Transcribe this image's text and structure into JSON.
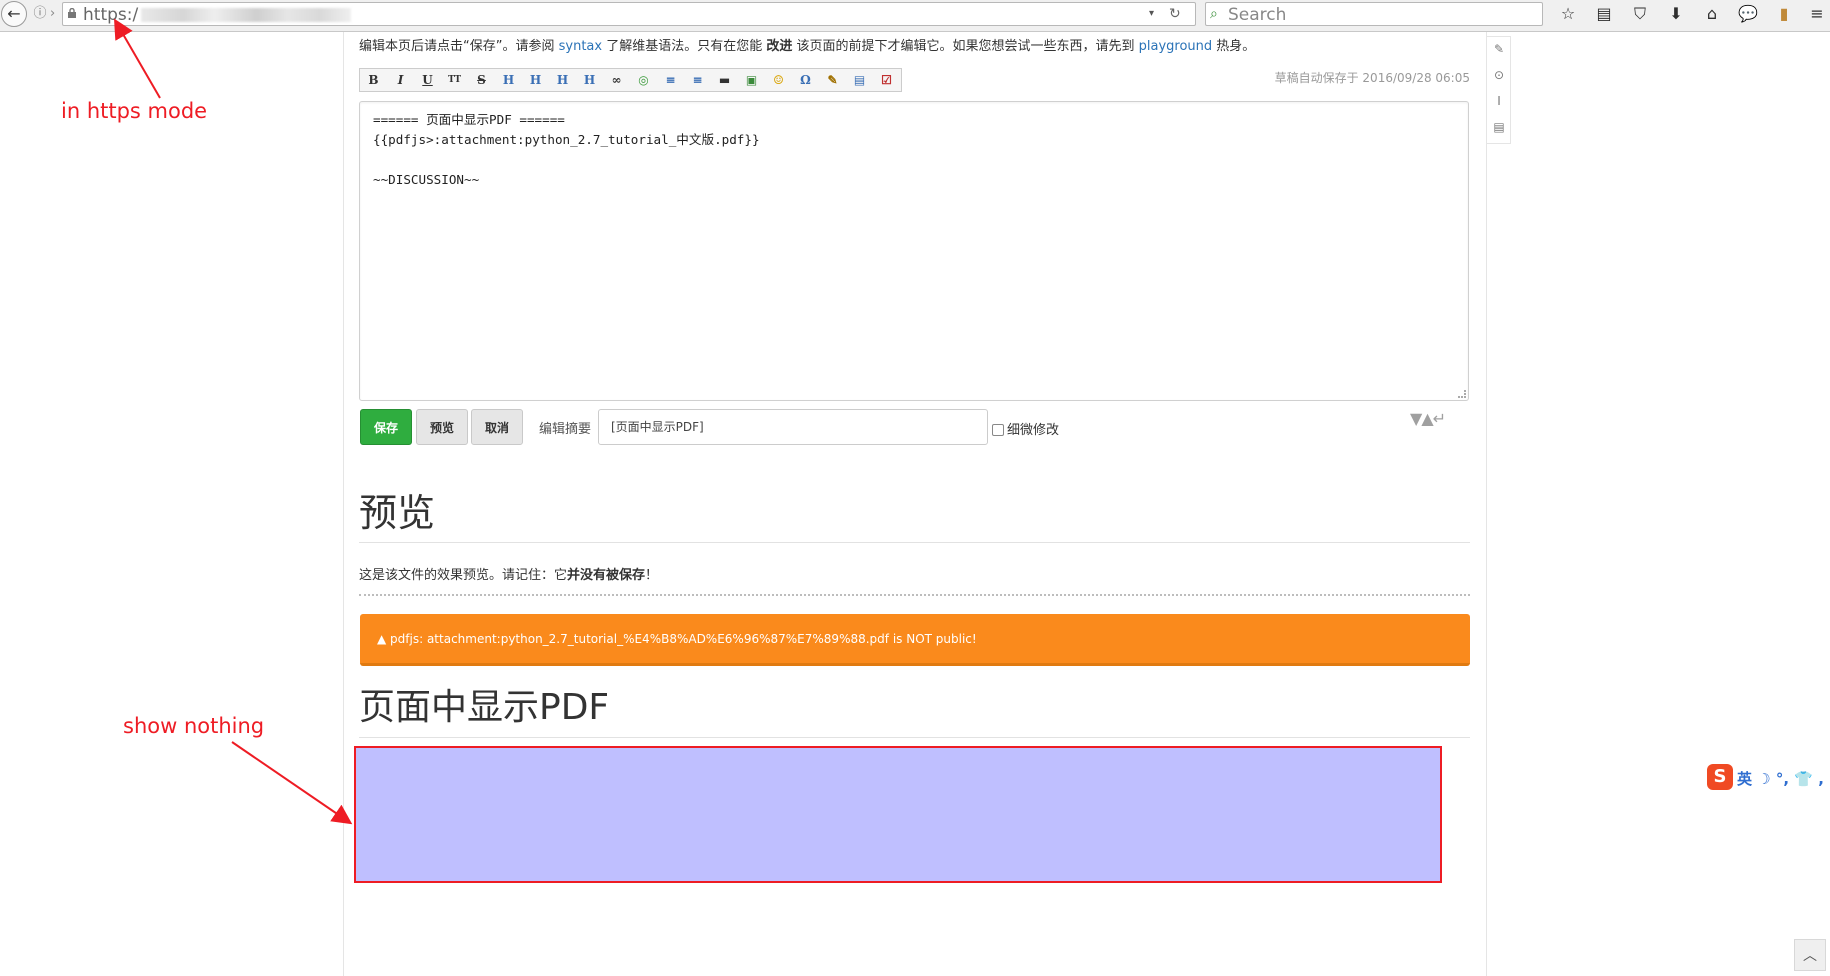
{
  "browser": {
    "url_visible": "https:/",
    "search_placeholder": "Search",
    "url_dropdown_glyph": "▾",
    "reload_glyph": "↻",
    "toolbar_icons": [
      "star-icon",
      "reading-list-icon",
      "pocket-icon",
      "download-icon",
      "home-icon",
      "chat-icon",
      "extension-icon",
      "menu-icon"
    ]
  },
  "intro": {
    "part1": "编辑本页后请点击“保存”。请参阅 ",
    "syntax_link": "syntax",
    "part2": " 了解维基语法。只有在您能 ",
    "improve": "改进",
    "part3": " 该页面的前提下才编辑它。如果您想尝试一些东西，请先到 ",
    "playground_link": "playground",
    "part4": " 热身。"
  },
  "edit_toolbar": [
    "B",
    "I",
    "U",
    "TT",
    "S",
    "H",
    "H",
    "H",
    "H",
    "∞",
    "◎",
    "≡",
    "≡",
    "▬",
    "▣",
    "☺",
    "Ω",
    "✎",
    "▤",
    "☑"
  ],
  "draft": "草稿自动保存于 2016/09/28 06:05",
  "editor": {
    "content": "====== 页面中显示PDF ======\n{{pdfjs>:attachment:python_2.7_tutorial_中文版.pdf}}\n\n~~DISCUSSION~~"
  },
  "buttons": {
    "save": "保存",
    "preview": "预览",
    "cancel": "取消"
  },
  "summary": {
    "label": "编辑摘要",
    "value": "[页面中显示PDF]"
  },
  "minor_edit_label": "细微修改",
  "preview": {
    "title": "预览",
    "note_prefix": "这是该文件的效果预览。请记住：它",
    "note_bold": "并没有被保存",
    "note_suffix": "！"
  },
  "warning": "pdfjs: attachment:python_2.7_tutorial_%E4%B8%AD%E6%96%87%E7%89%88.pdf is NOT public!",
  "doc_title": "页面中显示PDF",
  "annotations": {
    "https_note": "in https mode",
    "nothing_note": "show nothing",
    "color": "#ee1c24"
  },
  "ime": {
    "logo": "S",
    "text": "英 ☽ °, 👕 ,"
  },
  "colors": {
    "save": "#2fad3f",
    "warning": "#fa8a1c",
    "pdf_area": "#bfbfff",
    "link": "#2b73b7"
  }
}
